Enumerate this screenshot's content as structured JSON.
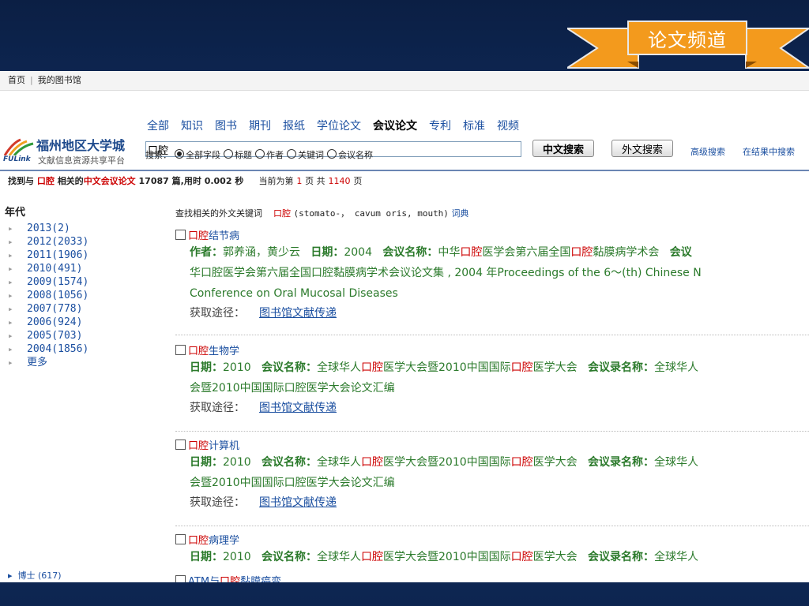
{
  "ribbon": {
    "label": "论文频道",
    "color": "#f39a1d"
  },
  "topnav": {
    "home": "首页",
    "sep": "|",
    "library": "我的图书馆"
  },
  "logo": {
    "name": "福州地区大学城",
    "en": "FULink",
    "sub": "文献信息资源共享平台"
  },
  "categories": [
    "全部",
    "知识",
    "图书",
    "期刊",
    "报纸",
    "学位论文",
    "会议论文",
    "专利",
    "标准",
    "视频"
  ],
  "active_category": "会议论文",
  "search": {
    "query": "口腔",
    "btn_cn": "中文搜索",
    "btn_en": "外文搜索",
    "advanced": "高级搜索",
    "within": "在结果中搜索"
  },
  "scope": {
    "label": "搜索：",
    "options": [
      "全部字段",
      "标题",
      "作者",
      "关键词",
      "会议名称"
    ],
    "selected": "全部字段"
  },
  "summary": {
    "p1": "找到与",
    "keyword": "口腔",
    "p2": "相关的",
    "type": "中文会议论文",
    "count": "17087",
    "p3": "篇,用时",
    "time": "0.002",
    "p4": "秒",
    "page_p1": "当前为第",
    "page": "1",
    "page_p2": "页 共",
    "pages": "1140",
    "page_p3": "页"
  },
  "sidebar": {
    "heading": "年代",
    "years": [
      "2013(2)",
      "2012(2033)",
      "2011(1906)",
      "2010(491)",
      "2009(1574)",
      "2008(1056)",
      "2007(778)",
      "2006(924)",
      "2005(703)",
      "2004(1856)"
    ],
    "more": "更多",
    "bottom_filter": "博士 (617)"
  },
  "related": {
    "label": "查找相关的外文关键词",
    "keyword": "口腔",
    "terms": "(stomato-， cavum oris, mouth)",
    "dict": "词典"
  },
  "results": [
    {
      "hl": "口腔",
      "rest": "结节病",
      "line1": [
        {
          "k": "作者：",
          "v": "郭养涵，黄少云"
        },
        {
          "k": "日期：",
          "v": "2004"
        },
        {
          "k": "会议名称：",
          "v": "中华口腔医学会第六届全国口腔黏膜病学术会"
        },
        {
          "k": "会议",
          "v": ""
        }
      ],
      "line2": "华口腔医学会第六届全国口腔黏膜病学术会议论文集 , 2004 年Proceedings of the 6～(th) Chinese N",
      "line3": "Conference on Oral Mucosal Diseases",
      "obtain_label": "获取途径：",
      "obtain_link": "图书馆文献传递"
    },
    {
      "hl": "口腔",
      "rest": "生物学",
      "line1": [
        {
          "k": "日期：",
          "v": "2010"
        },
        {
          "k": "会议名称：",
          "v": "全球华人口腔医学大会暨2010中国国际口腔医学大会"
        },
        {
          "k": "会议录名称：",
          "v": "全球华人"
        }
      ],
      "line2": "会暨2010中国国际口腔医学大会论文汇编",
      "obtain_label": "获取途径：",
      "obtain_link": "图书馆文献传递"
    },
    {
      "hl": "口腔",
      "rest": "计算机",
      "line1": [
        {
          "k": "日期：",
          "v": "2010"
        },
        {
          "k": "会议名称：",
          "v": "全球华人口腔医学大会暨2010中国国际口腔医学大会"
        },
        {
          "k": "会议录名称：",
          "v": "全球华人"
        }
      ],
      "line2": "会暨2010中国国际口腔医学大会论文汇编",
      "obtain_label": "获取途径：",
      "obtain_link": "图书馆文献传递"
    },
    {
      "hl": "口腔",
      "rest": "病理学",
      "line1": [
        {
          "k": "日期：",
          "v": "2010"
        },
        {
          "k": "会议名称：",
          "v": "全球华人口腔医学大会暨2010中国国际口腔医学大会"
        },
        {
          "k": "会议录名称：",
          "v": "全球华人"
        }
      ]
    },
    {
      "pre": "ATM与",
      "hl": "口腔",
      "rest": "黏膜癌变"
    }
  ]
}
